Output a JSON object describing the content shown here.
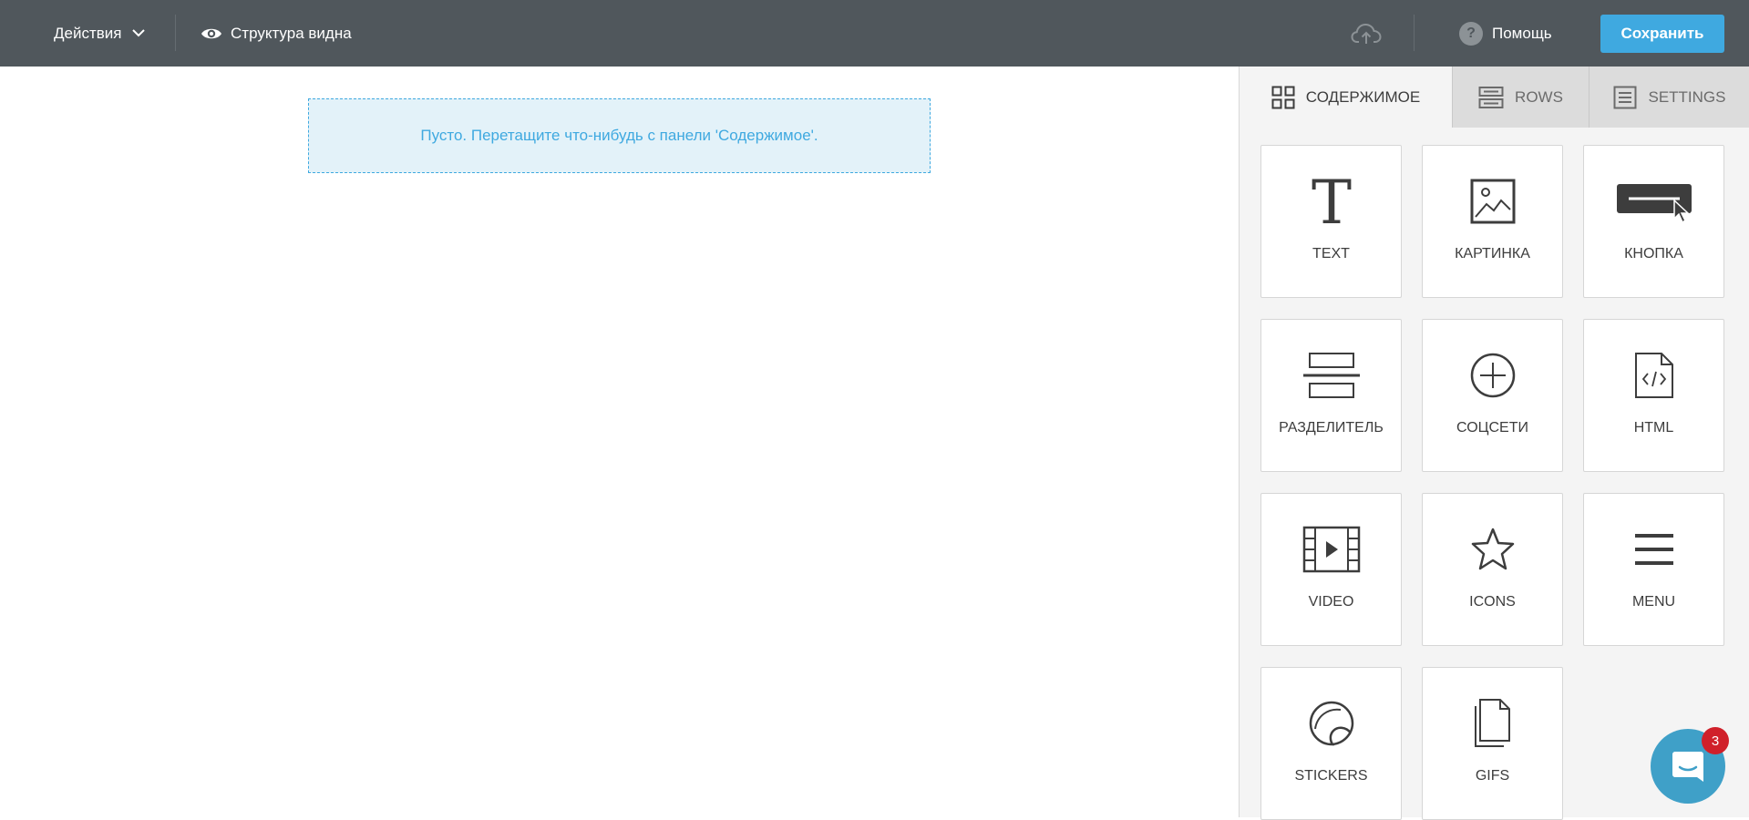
{
  "topbar": {
    "actions_label": "Действия",
    "structure_label": "Структура видна",
    "help_label": "Помощь",
    "save_label": "Сохранить",
    "background_color": "#50575c",
    "save_color": "#3fa9e0"
  },
  "canvas": {
    "empty_message": "Пусто. Перетащите что-нибудь с панели 'Содержимое'."
  },
  "panel": {
    "tabs": [
      {
        "label": "СОДЕРЖИМОЕ",
        "icon": "grid-icon",
        "active": true
      },
      {
        "label": "ROWS",
        "icon": "rows-icon",
        "active": false
      },
      {
        "label": "SETTINGS",
        "icon": "settings-doc-icon",
        "active": false
      }
    ],
    "blocks": [
      {
        "label": "TEXT",
        "icon": "text-icon"
      },
      {
        "label": "КАРТИНКА",
        "icon": "image-icon"
      },
      {
        "label": "КНОПКА",
        "icon": "button-icon"
      },
      {
        "label": "РАЗДЕЛИТЕЛЬ",
        "icon": "divider-icon"
      },
      {
        "label": "СОЦСЕТИ",
        "icon": "social-plus-icon"
      },
      {
        "label": "HTML",
        "icon": "html-code-icon"
      },
      {
        "label": "VIDEO",
        "icon": "video-icon"
      },
      {
        "label": "ICONS",
        "icon": "star-icon"
      },
      {
        "label": "MENU",
        "icon": "menu-icon"
      },
      {
        "label": "STICKERS",
        "icon": "sticker-icon"
      },
      {
        "label": "GIFS",
        "icon": "gif-file-icon"
      }
    ]
  },
  "chat": {
    "badge_count": "3",
    "color": "#3fa0c8"
  }
}
